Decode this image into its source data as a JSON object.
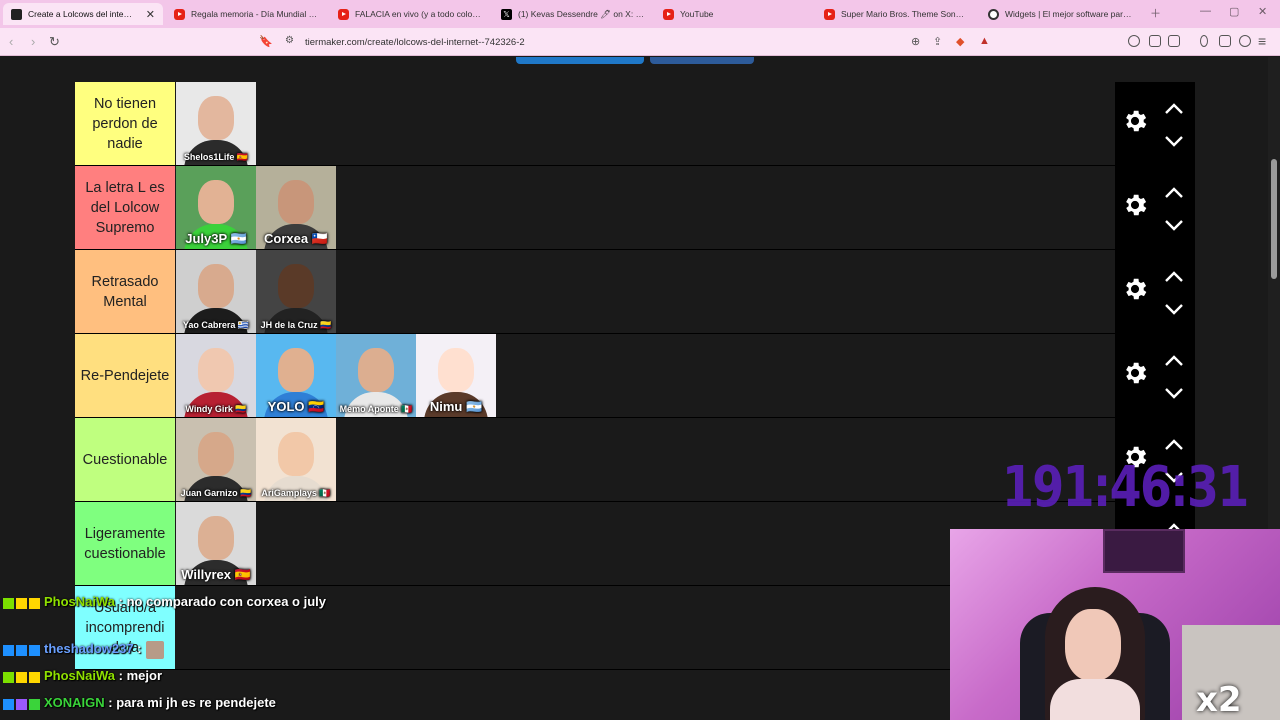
{
  "browser": {
    "tabs": [
      {
        "title": "Create a Lolcows del internet Ti",
        "icon": "tiermaker-icon",
        "active": true
      },
      {
        "title": "Regala memoria - Día Mundial del A",
        "icon": "youtube-icon"
      },
      {
        "title": "FALACIA en vivo (y a todo color) - Ri",
        "icon": "youtube-icon"
      },
      {
        "title": "(1) Kevas Dessendre 🖊 on X: \"@Ha",
        "icon": "x-icon"
      },
      {
        "title": "YouTube",
        "icon": "youtube-icon"
      },
      {
        "title": "Super Mario Bros. Theme Song - You",
        "icon": "youtube-icon"
      },
      {
        "title": "Widgets | El mejor software para pc",
        "icon": "widgets-icon"
      }
    ],
    "url": "tiermaker.com/create/lolcows-del-internet--742326-2"
  },
  "tiers": [
    {
      "label": "No tienen perdon de nadie",
      "color": "#ffff7f",
      "items": [
        {
          "name": "Shelos1Life 🇪🇸",
          "shirt": "#2b2b2b",
          "bg": "#e8e8e8",
          "skin": "#e3b79e",
          "small": true
        }
      ]
    },
    {
      "label": "La letra L es del Lolcow Supremo",
      "color": "#ff7f7f",
      "items": [
        {
          "name": "July3P 🇦🇷",
          "shirt": "#3bd13b",
          "bg": "#5aa05a",
          "skin": "#e2b294"
        },
        {
          "name": "Corxea 🇨🇱",
          "shirt": "#3c3c3c",
          "bg": "#b5b09a",
          "skin": "#c8967a"
        }
      ]
    },
    {
      "label": "Retrasado Mental",
      "color": "#ffbf7f",
      "items": [
        {
          "name": "Yao Cabrera 🇺🇾",
          "shirt": "#1c1c1c",
          "bg": "#cfcfcf",
          "skin": "#d8aa8e",
          "small": true
        },
        {
          "name": "JH de la Cruz 🇨🇴",
          "shirt": "#222",
          "bg": "#444",
          "skin": "#5a3a28",
          "small": true
        }
      ]
    },
    {
      "label": "Re-Pendejete",
      "color": "#ffdf7f",
      "items": [
        {
          "name": "Windy Girk 🇨🇴",
          "shirt": "#b72032",
          "bg": "#d8d8e0",
          "skin": "#f0c8b0",
          "small": true
        },
        {
          "name": "YOLO 🇻🇪",
          "shirt": "#2f7fd6",
          "bg": "#58b8f0",
          "skin": "#e0b090"
        },
        {
          "name": "Memo Aponte 🇲🇽",
          "shirt": "#e8e8e8",
          "bg": "#6fb0d8",
          "skin": "#dcae90",
          "small": true
        },
        {
          "name": "Nimu 🇦🇷",
          "shirt": "#5a3a2a",
          "bg": "#f4f0f6",
          "skin": "#ffe0d0"
        }
      ]
    },
    {
      "label": "Cuestionable",
      "color": "#bfff7f",
      "items": [
        {
          "name": "Juan Garnizo 🇨🇴",
          "shirt": "#2c2c2c",
          "bg": "#c9c0b0",
          "skin": "#d6a88a",
          "small": true
        },
        {
          "name": "AriGamplays 🇲🇽",
          "shirt": "#e6dcd0",
          "bg": "#f2e2d2",
          "skin": "#f2c8a8",
          "small": true
        }
      ]
    },
    {
      "label": "Ligeramente cuestionable",
      "color": "#7fff7f",
      "items": [
        {
          "name": "Willyrex 🇪🇸",
          "shirt": "#2c2c2c",
          "bg": "#dadada",
          "skin": "#dcb094"
        }
      ]
    },
    {
      "label": "Usuario/a incomprendi do/a",
      "color": "#7fffff",
      "items": []
    }
  ],
  "overlay": {
    "timer": "191:46:31",
    "cat_caption": "x2"
  },
  "chat": [
    {
      "user": "PhosNaiWa",
      "user_color": "#8fe000",
      "text": ": no comparado con corxea o july",
      "badges": [
        "#7ce000",
        "#ffd700",
        "#ffd700"
      ]
    },
    {
      "user": "theshadow237",
      "user_color": "#6aa0ff",
      "text": ":",
      "badges": [
        "#1e90ff",
        "#1e90ff",
        "#1e90ff"
      ],
      "emote": true
    },
    {
      "user": "PhosNaiWa",
      "user_color": "#8fe000",
      "text": ": mejor",
      "badges": [
        "#7ce000",
        "#ffd700",
        "#ffd700"
      ]
    },
    {
      "user": "XONAIGN",
      "user_color": "#3ad43a",
      "text": ": para mi jh es re pendejete",
      "badges": [
        "#1e90ff",
        "#9b59ff",
        "#3ad43a"
      ]
    }
  ]
}
